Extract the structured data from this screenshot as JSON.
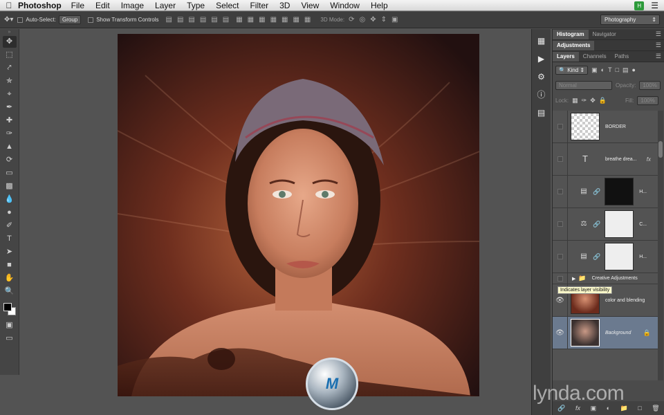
{
  "menubar": {
    "app_name": "Photoshop",
    "items": [
      "File",
      "Edit",
      "Image",
      "Layer",
      "Type",
      "Select",
      "Filter",
      "3D",
      "View",
      "Window",
      "Help"
    ],
    "status_badge": "H"
  },
  "options_bar": {
    "auto_select_label": "Auto-Select:",
    "auto_select_value": "Group",
    "show_transform_label": "Show Transform Controls",
    "mode_3d_label": "3D Mode:",
    "workspace": "Photography"
  },
  "panels": {
    "top_tabs": [
      "Histogram",
      "Navigator"
    ],
    "adjustments_tab": "Adjustments",
    "layer_tabs": [
      "Layers",
      "Channels",
      "Paths"
    ],
    "filter_kind": "Kind",
    "blend_mode": "Normal",
    "opacity_label": "Opacity:",
    "opacity_value": "100%",
    "lock_label": "Lock:",
    "fill_label": "Fill:",
    "fill_value": "100%"
  },
  "layers": [
    {
      "name": "BORDER",
      "type": "pixel",
      "visible": false
    },
    {
      "name": "breathe drea...",
      "type": "text",
      "fx": "fx",
      "visible": false
    },
    {
      "name": "H...",
      "type": "adjustment",
      "mask": "dark",
      "visible": false
    },
    {
      "name": "C...",
      "type": "adjustment",
      "mask": "light",
      "visible": false
    },
    {
      "name": "H...",
      "type": "adjustment",
      "mask": "light",
      "visible": false
    }
  ],
  "group": {
    "name": "Creative Adjustments"
  },
  "bottom_layers": [
    {
      "name": "color and blending",
      "visible": true
    },
    {
      "name": "Background",
      "visible": true,
      "selected": true,
      "locked": true
    }
  ],
  "tooltip": "Indicates layer visibility",
  "watermarks": {
    "circle_text": "M",
    "brand": "lynda.com"
  }
}
